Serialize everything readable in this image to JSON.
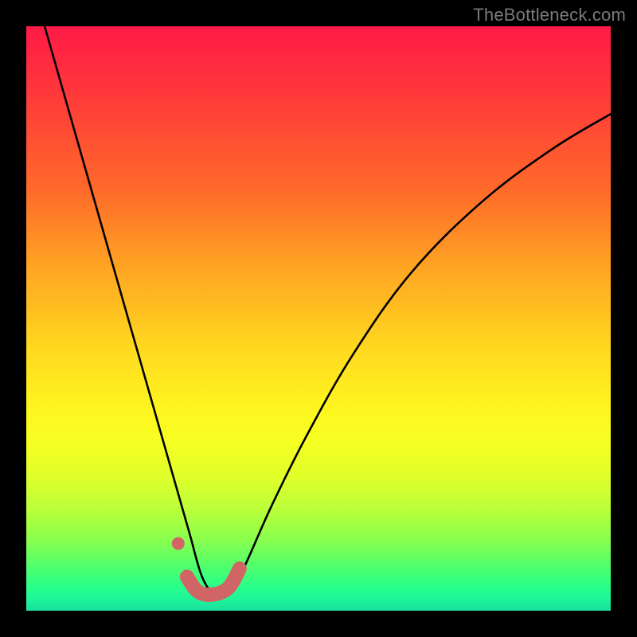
{
  "watermark": "TheBottleneck.com",
  "colors": {
    "frame": "#000000",
    "watermark": "#7a7a7a",
    "curve": "#000000",
    "marker": "#d16464"
  },
  "chart_data": {
    "type": "line",
    "title": "",
    "xlabel": "",
    "ylabel": "",
    "xlim": [
      0,
      100
    ],
    "ylim": [
      0,
      100
    ],
    "note": "y-axis inverted visually (0 at bottom, 100 at top). Curve shows bottleneck; minimum near x≈31.",
    "series": [
      {
        "name": "bottleneck-curve",
        "x": [
          2,
          6,
          10,
          14,
          18,
          22,
          24,
          26,
          28,
          30,
          32,
          34,
          36,
          38,
          42,
          48,
          56,
          66,
          78,
          90,
          100
        ],
        "y": [
          104,
          90,
          76,
          62,
          48,
          34,
          27,
          20,
          13,
          6,
          3,
          3,
          5,
          9,
          18,
          30,
          44,
          58,
          70,
          79,
          85
        ]
      }
    ],
    "markers": {
      "dot": {
        "x": 26.0,
        "y": 11.5
      },
      "segment": {
        "x": [
          27.5,
          29.0,
          30.5,
          32.0,
          33.5,
          35.0,
          36.5
        ],
        "y": [
          5.8,
          3.6,
          2.8,
          2.8,
          3.2,
          4.4,
          7.2
        ]
      }
    }
  }
}
